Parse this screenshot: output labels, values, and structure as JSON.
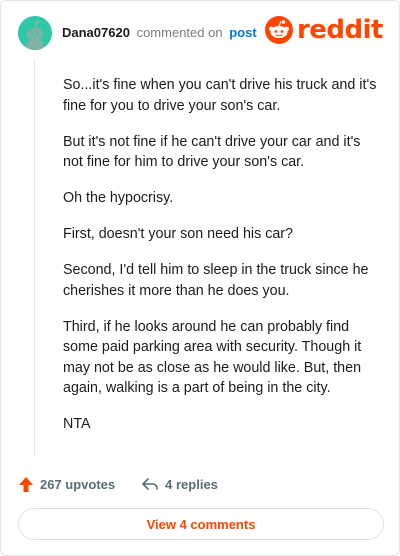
{
  "header": {
    "username": "Dana07620",
    "verb": "commented on",
    "post_link": "post",
    "brand": "reddit"
  },
  "comment": {
    "paragraphs": [
      "So...it's fine when you can't drive his truck and it's fine for you to drive your son's car.",
      "But it's not fine if he can't drive your car and it's not fine for him to drive your son's car.",
      "Oh the hypocrisy.",
      "First, doesn't your son need his car?",
      "Second, I'd tell him to sleep in the truck since he cherishes it more than he does you.",
      "Third, if he looks around he can probably find some paid parking area with security. Though it may not be as close as he would like. But, then again, walking is a part of being in the city.",
      "NTA"
    ]
  },
  "actions": {
    "upvotes": "267 upvotes",
    "replies": "4 replies"
  },
  "footer": {
    "view_comments": "View 4 comments"
  },
  "colors": {
    "accent": "#ff4500",
    "avatar": "#2ec8a7",
    "link": "#0079d3",
    "muted": "#576f76"
  },
  "icons": [
    "snoo-avatar-icon",
    "reddit-snoo-icon",
    "upvote-arrow-icon",
    "reply-arrow-icon"
  ]
}
